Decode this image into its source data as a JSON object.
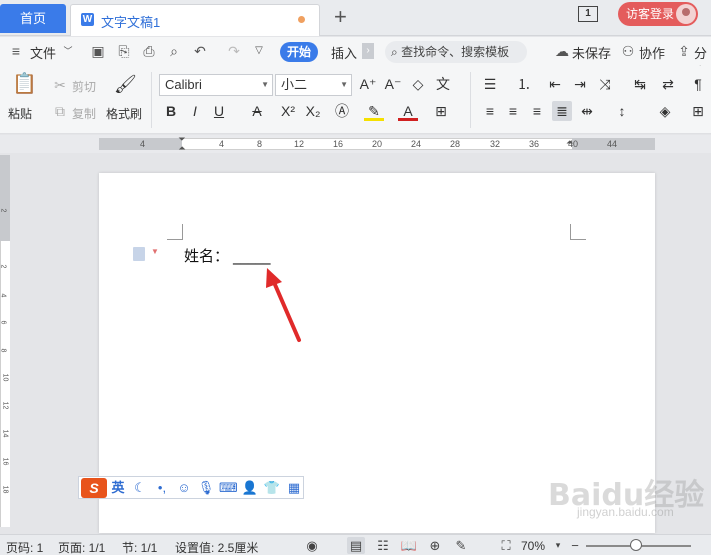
{
  "tabs": {
    "home_label": "首页",
    "doc_label": "文字文稿1",
    "doc_logo": "W",
    "new_tab": "+",
    "page_icon": "1",
    "login_label": "访客登录"
  },
  "menubar": {
    "file_label": "文件",
    "start_label": "开始",
    "insert_label": "插入",
    "search_label": "查找命令、搜索模板",
    "unsaved_label": "未保存",
    "collab_label": "协作",
    "share_label": "分享"
  },
  "ribbon": {
    "paste_label": "粘贴",
    "cut_label": "剪切",
    "copy_label": "复制",
    "format_painter_label": "格式刷",
    "font_name": "Calibri",
    "font_size": "小二"
  },
  "ruler": {
    "numbers": [
      "4",
      "4",
      "8",
      "12",
      "16",
      "20",
      "24",
      "28",
      "32",
      "36",
      "40",
      "44"
    ],
    "vnumbers": [
      "2",
      "2",
      "4",
      "6",
      "8",
      "10",
      "12",
      "14",
      "16",
      "18"
    ]
  },
  "document": {
    "text_label": "姓名：",
    "text_blank": "_____"
  },
  "ime": {
    "logo": "S",
    "lang": "英"
  },
  "status": {
    "page_code": "页码: 1",
    "pages": "页面: 1/1",
    "section": "节: 1/1",
    "setting": "设置值: 2.5厘米",
    "zoom": "70%"
  },
  "watermark": {
    "brand": "Baidu经验",
    "sub": "jingyan.baidu.com"
  },
  "colors": {
    "accent": "#3a7be9",
    "login": "#e45c5c",
    "arrow": "#e02a2a",
    "ime_logo": "#e8541c"
  }
}
